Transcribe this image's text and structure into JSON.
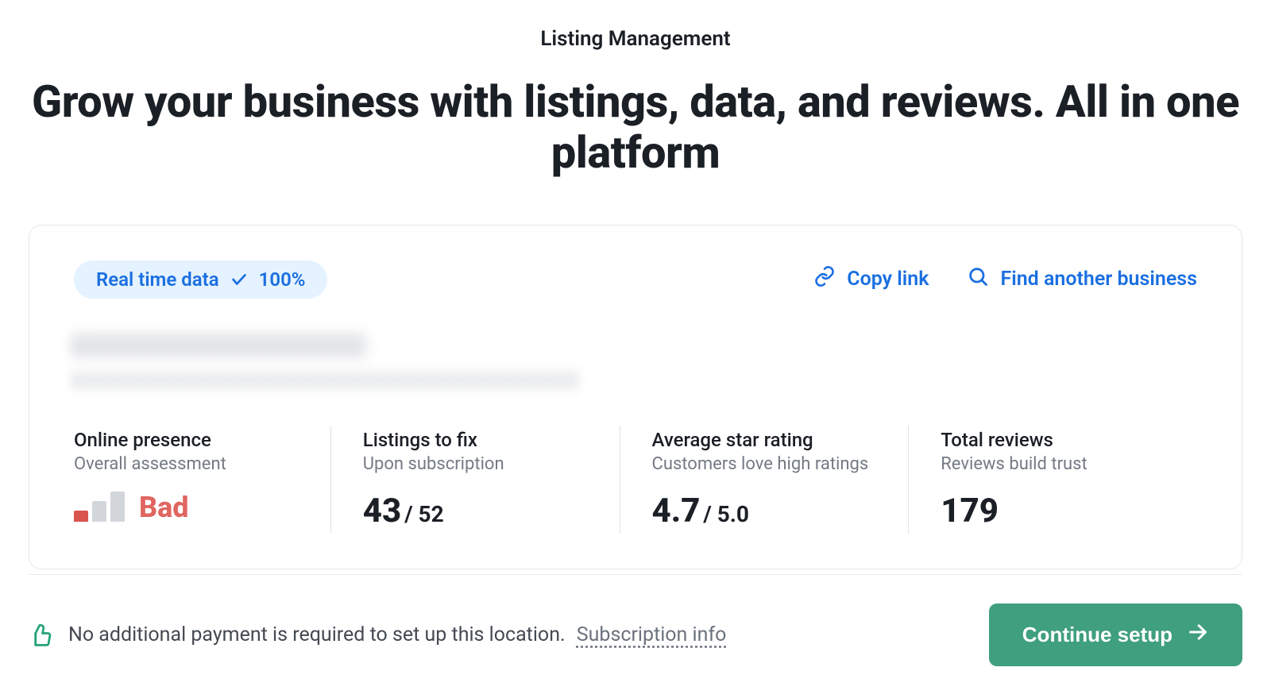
{
  "header": {
    "eyebrow": "Listing Management",
    "headline": "Grow your business with listings, data, and reviews. All in one platform"
  },
  "card": {
    "badge": {
      "label": "Real time data",
      "value": "100%"
    },
    "actions": {
      "copy": "Copy link",
      "find": "Find another business"
    },
    "metrics": {
      "presence": {
        "title": "Online presence",
        "subtitle": "Overall assessment",
        "status": "Bad"
      },
      "fix": {
        "title": "Listings to fix",
        "subtitle": "Upon subscription",
        "value": "43",
        "total": " / 52"
      },
      "rating": {
        "title": "Average star rating",
        "subtitle": "Customers love high ratings",
        "value": "4.7",
        "total": " / 5.0"
      },
      "reviews": {
        "title": "Total reviews",
        "subtitle": "Reviews build trust",
        "value": "179"
      }
    }
  },
  "footer": {
    "message": "No additional payment is required to set up this location.",
    "sub_link": "Subscription info",
    "cta": "Continue setup"
  }
}
